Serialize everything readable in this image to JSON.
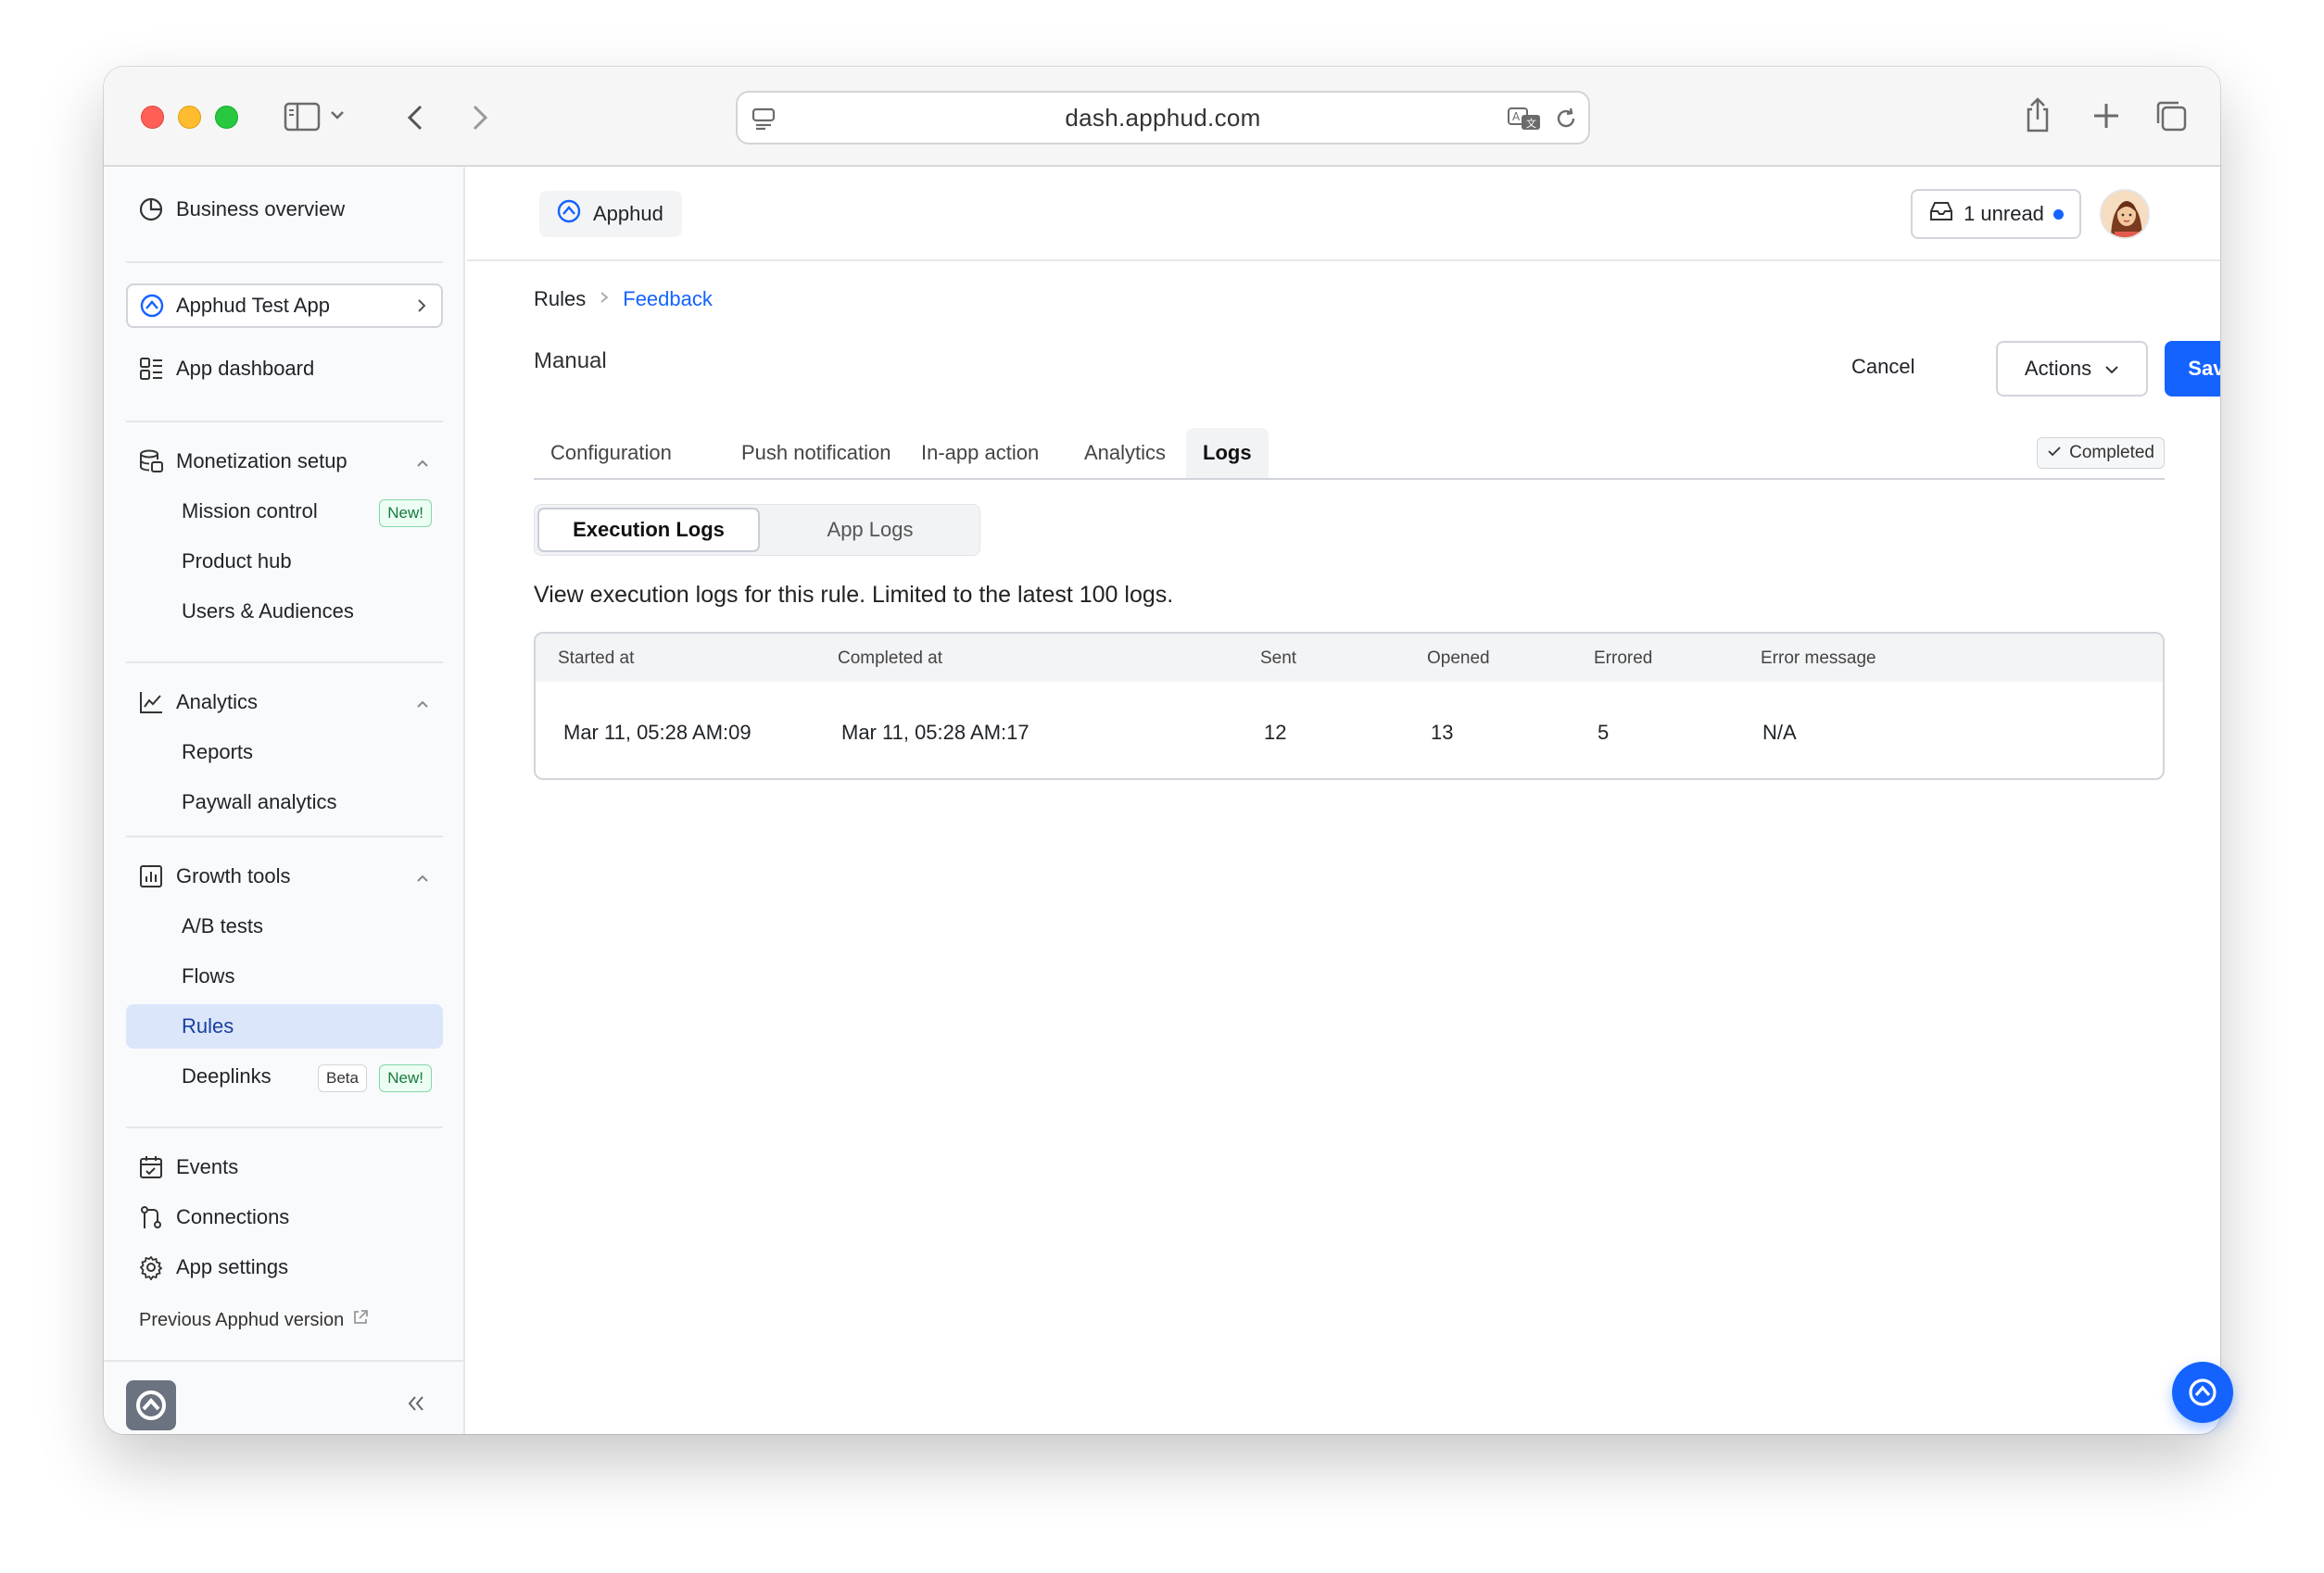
{
  "browser": {
    "url": "dash.apphud.com"
  },
  "sidebar": {
    "business_overview": "Business overview",
    "app_selector": "Apphud Test App",
    "app_dashboard": "App dashboard",
    "monetization": {
      "title": "Monetization setup",
      "items": [
        {
          "label": "Mission control",
          "badge": "New!"
        },
        {
          "label": "Product hub"
        },
        {
          "label": "Users & Audiences"
        }
      ]
    },
    "analytics": {
      "title": "Analytics",
      "items": [
        {
          "label": "Reports"
        },
        {
          "label": "Paywall analytics"
        }
      ]
    },
    "growth": {
      "title": "Growth tools",
      "items": [
        {
          "label": "A/B tests"
        },
        {
          "label": "Flows"
        },
        {
          "label": "Rules",
          "active": true
        },
        {
          "label": "Deeplinks",
          "badge_beta": "Beta",
          "badge": "New!"
        }
      ]
    },
    "bottom": [
      {
        "label": "Events",
        "icon": "calendar-icon"
      },
      {
        "label": "Connections",
        "icon": "git-icon"
      },
      {
        "label": "App settings",
        "icon": "gear-icon"
      }
    ],
    "previous_version": "Previous Apphud version"
  },
  "topbar": {
    "app_chip": "Apphud",
    "unread": "1 unread"
  },
  "breadcrumb": {
    "root": "Rules",
    "current": "Feedback"
  },
  "page": {
    "title": "Manual",
    "cancel": "Cancel",
    "actions": "Actions",
    "save": "Save"
  },
  "tabs": {
    "items": [
      "Configuration",
      "Push notification",
      "In-app action",
      "Analytics",
      "Logs"
    ],
    "active": "Logs",
    "status": "Completed"
  },
  "segment": {
    "active": "Execution Logs",
    "inactive": "App Logs"
  },
  "description": "View execution logs for this rule. Limited to the latest 100 logs.",
  "table": {
    "columns": [
      "Started at",
      "Completed at",
      "Sent",
      "Opened",
      "Errored",
      "Error message"
    ],
    "rows": [
      [
        "Mar 11, 05:28 AM:09",
        "Mar 11, 05:28 AM:17",
        "12",
        "13",
        "5",
        "N/A"
      ]
    ]
  },
  "colors": {
    "accent": "#1463ff",
    "active_nav_bg": "#dbe6fb"
  }
}
